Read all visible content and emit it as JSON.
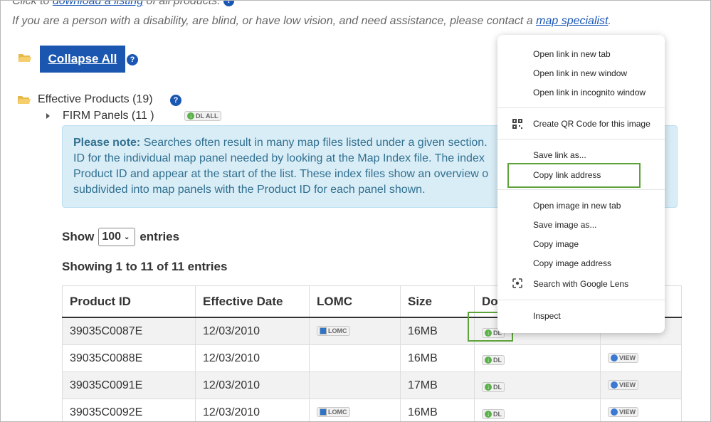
{
  "intro": {
    "download_prefix": "Click to ",
    "download_link": "download a listing",
    "download_suffix": " of all products. ",
    "assist_text": "If you are a person with a disability, are blind, or have low vision, and need assistance, please contact a ",
    "assist_link": "map specialist",
    "assist_end": ".",
    "help_glyph": "?"
  },
  "controls": {
    "collapse_all": "Collapse All",
    "effective_products": "Effective Products (19)",
    "firm_panels": "FIRM Panels (11 )",
    "dl_all": "DL ALL"
  },
  "note": {
    "label": "Please note:",
    "line1": " Searches often result in many map files listed under a given section.",
    "line2": "ID for the individual map panel needed by looking at the Map Index file. The index",
    "line3": "Product ID and appear at the start of the list. These index files show an overview o",
    "line4": "subdivided into map panels with the Product ID for each panel shown."
  },
  "entries": {
    "show": "Show",
    "selected": "100",
    "entries": "entries",
    "showing": "Showing 1 to 11 of 11 entries"
  },
  "table": {
    "headers": [
      "Product ID",
      "Effective Date",
      "LOMC",
      "Size",
      "Do",
      ""
    ],
    "rows": [
      {
        "id": "39035C0087E",
        "date": "12/03/2010",
        "lomc": "LOMC",
        "size": "16MB",
        "dl": "DL",
        "view": ""
      },
      {
        "id": "39035C0088E",
        "date": "12/03/2010",
        "lomc": "",
        "size": "16MB",
        "dl": "DL",
        "view": "VIEW"
      },
      {
        "id": "39035C0091E",
        "date": "12/03/2010",
        "lomc": "",
        "size": "17MB",
        "dl": "DL",
        "view": "VIEW"
      },
      {
        "id": "39035C0092E",
        "date": "12/03/2010",
        "lomc": "LOMC",
        "size": "16MB",
        "dl": "DL",
        "view": "VIEW"
      }
    ]
  },
  "context_menu": {
    "open_new_tab": "Open link in new tab",
    "open_new_window": "Open link in new window",
    "open_incognito": "Open link in incognito window",
    "qr_code": "Create QR Code for this image",
    "save_link": "Save link as...",
    "copy_link": "Copy link address",
    "open_image": "Open image in new tab",
    "save_image": "Save image as...",
    "copy_image": "Copy image",
    "copy_image_address": "Copy image address",
    "google_lens": "Search with Google Lens",
    "inspect": "Inspect"
  },
  "colors": {
    "link_blue": "#1a57b5",
    "note_bg": "#d9edf7",
    "highlight_green": "#5ea33a"
  }
}
